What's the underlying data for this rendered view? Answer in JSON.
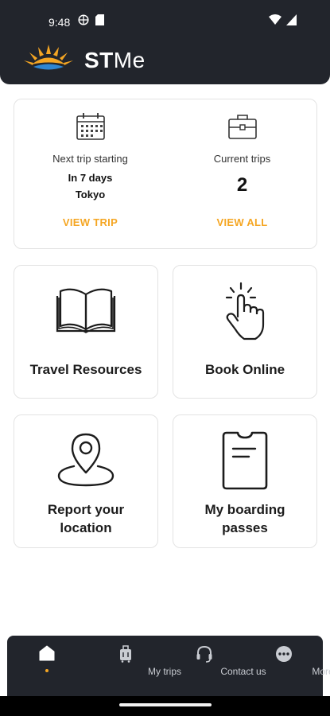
{
  "status_bar": {
    "time": "9:48",
    "left_icons": [
      "vpn-globe-icon",
      "sim-card-icon"
    ],
    "right_icons": [
      "wifi-icon",
      "cell-signal-icon"
    ]
  },
  "app": {
    "logo_text_bold": "ST",
    "logo_text_regular": "Me",
    "accent_color": "#f5a623",
    "header_color": "#22252c"
  },
  "trips_card": {
    "next_trip": {
      "icon": "calendar-icon",
      "label": "Next trip starting",
      "when": "In 7 days",
      "where": "Tokyo",
      "action": "VIEW TRIP"
    },
    "current_trips": {
      "icon": "briefcase-icon",
      "label": "Current trips",
      "count": "2",
      "action": "VIEW ALL"
    }
  },
  "tiles": {
    "travel_resources": {
      "icon": "book-icon",
      "line1": "Travel Resources"
    },
    "book_online": {
      "icon": "tap-hand-icon",
      "line1": "Book Online"
    },
    "report_location": {
      "icon": "location-pin-icon",
      "line1": "Report your",
      "line2": "location"
    },
    "boarding_passes": {
      "icon": "boarding-pass-icon",
      "line1": "My boarding",
      "line2": "passes"
    }
  },
  "bottom_nav": {
    "items": [
      {
        "icon": "home-icon",
        "label": "",
        "active": true
      },
      {
        "icon": "luggage-icon",
        "label": "My trips"
      },
      {
        "icon": "headset-icon",
        "label": "Contact us"
      },
      {
        "icon": "more-dots-icon",
        "label": "More"
      }
    ]
  }
}
